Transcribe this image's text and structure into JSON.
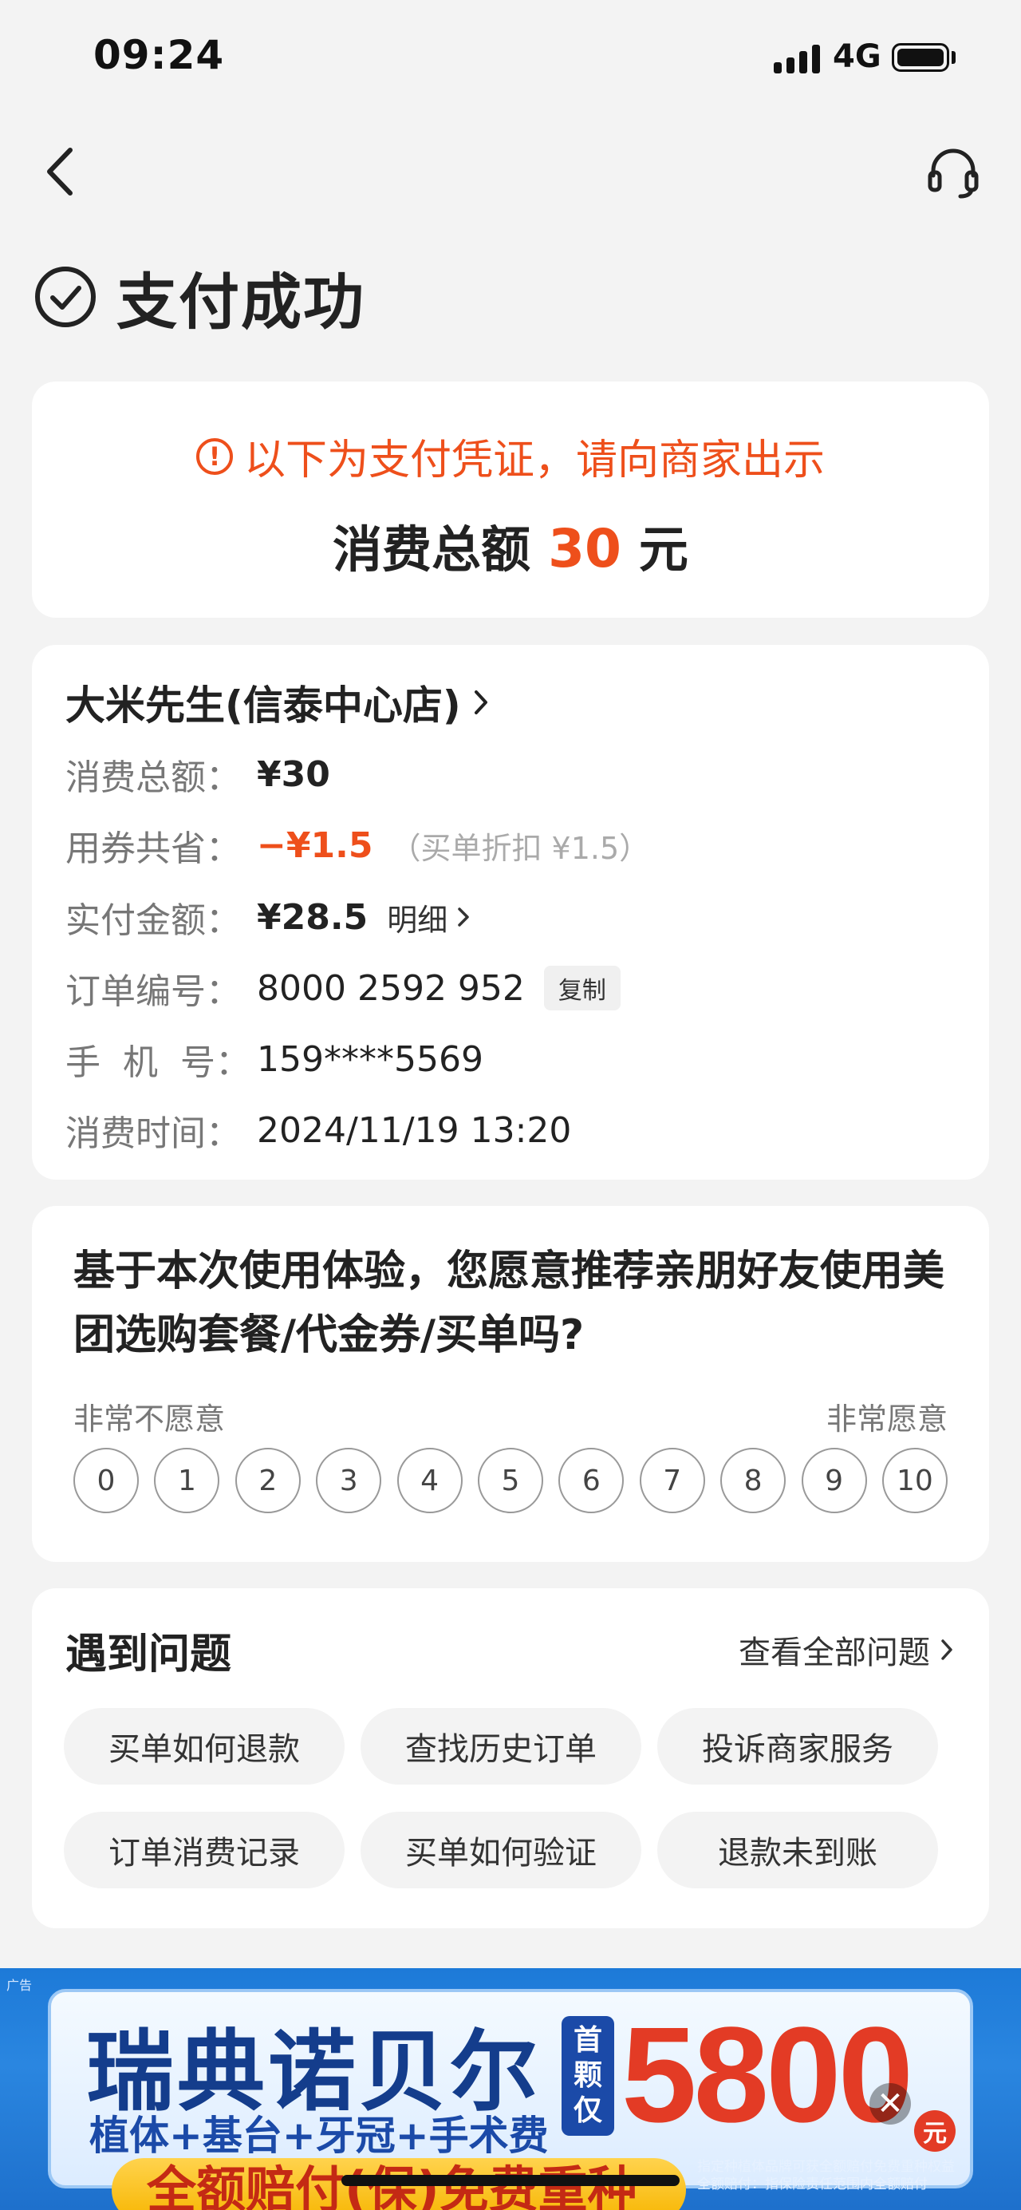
{
  "status_bar": {
    "time": "09:24",
    "network": "4G"
  },
  "header": {
    "title": "支付成功"
  },
  "voucher": {
    "notice": "以下为支付凭证，请向商家出示",
    "total_prefix": "消费总额",
    "total_amount": "30",
    "total_unit": "元"
  },
  "order": {
    "shop_name": "大米先生(信泰中心店)",
    "rows": {
      "total": {
        "label": "消费总额：",
        "value": "¥30"
      },
      "saved": {
        "label": "用券共省：",
        "value": "−¥1.5",
        "note": "（买单折扣 ¥1.5）"
      },
      "paid": {
        "label": "实付金额：",
        "value": "¥28.5",
        "link": "明细"
      },
      "order_no": {
        "label": "订单编号：",
        "value": "8000 2592 952",
        "copy": "复制"
      },
      "phone": {
        "label": "手  机  号：",
        "value": "159****5569"
      },
      "time": {
        "label": "消费时间：",
        "value": "2024/11/19 13:20"
      }
    }
  },
  "survey": {
    "question": "基于本次使用体验，您愿意推荐亲朋好友使用美团选购套餐/代金券/买单吗?",
    "low_label": "非常不愿意",
    "high_label": "非常愿意",
    "scale": [
      "0",
      "1",
      "2",
      "3",
      "4",
      "5",
      "6",
      "7",
      "8",
      "9",
      "10"
    ]
  },
  "problems": {
    "title": "遇到问题",
    "view_all": "查看全部问题",
    "items": [
      "买单如何退款",
      "查找历史订单",
      "投诉商家服务",
      "订单消费记录",
      "买单如何验证",
      "退款未到账"
    ]
  },
  "ad": {
    "tag": "广告",
    "brand": "瑞典诺贝尔",
    "sub": "植体+基台+牙冠+手术费",
    "badge": [
      "首",
      "颗",
      "仅"
    ],
    "price": "5800",
    "unit": "元",
    "strip": "全额赔付(保)免费重种",
    "fine_print": "指定种植体品牌可获全额赔付免费重种权益 全额赔付：指保险责任范围内全额赔付"
  },
  "colors": {
    "accent": "#ee4f1b",
    "background": "#f3f3f3",
    "card": "#ffffff"
  },
  "icons": [
    "back-icon",
    "headset-icon",
    "check-circle-icon",
    "warning-icon",
    "chevron-right-icon",
    "close-icon"
  ]
}
